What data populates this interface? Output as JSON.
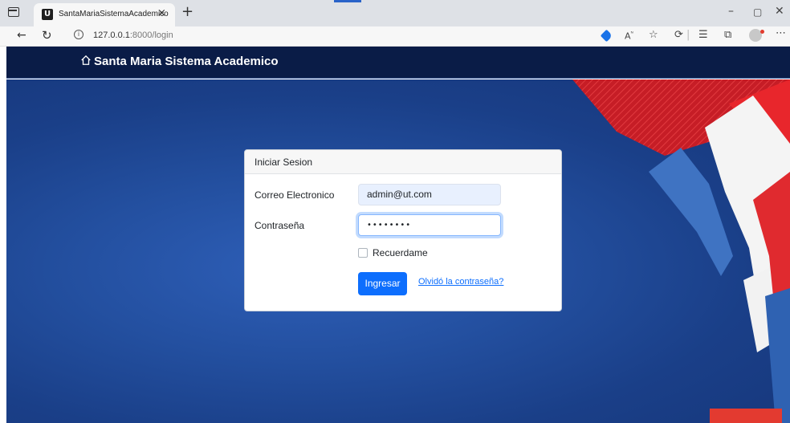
{
  "browser": {
    "tab_title": "SantaMariaSistemaAcademico",
    "tab_favicon_letter": "U",
    "tab_close": "×",
    "new_tab": "+",
    "address_host": "127.0.0.1",
    "address_path": ":8000/login",
    "window_min": "–",
    "window_max": "▢",
    "window_close": "✕",
    "icons": [
      "sidebar-icon",
      "back-icon",
      "reload-icon",
      "info-icon",
      "tag-icon",
      "read-aloud-icon",
      "favorite-icon",
      "extensions-icon",
      "favorites-list-icon",
      "collections-icon",
      "profile-icon",
      "more-icon"
    ]
  },
  "navbar": {
    "brand": "Santa Maria Sistema Academico"
  },
  "login": {
    "header": "Iniciar Sesion",
    "email_label": "Correo Electronico",
    "email_value": "admin@ut.com",
    "password_label": "Contraseña",
    "password_value": "••••••••",
    "remember_label": "Recuerdame",
    "remember_checked": false,
    "submit_label": "Ingresar",
    "forgot_label": "Olvidó la contraseña?"
  },
  "colors": {
    "navbar_bg": "#0a1c47",
    "hero_blue": "#234f9f",
    "primary": "#0d6efd",
    "accent_red": "#d8222a"
  }
}
